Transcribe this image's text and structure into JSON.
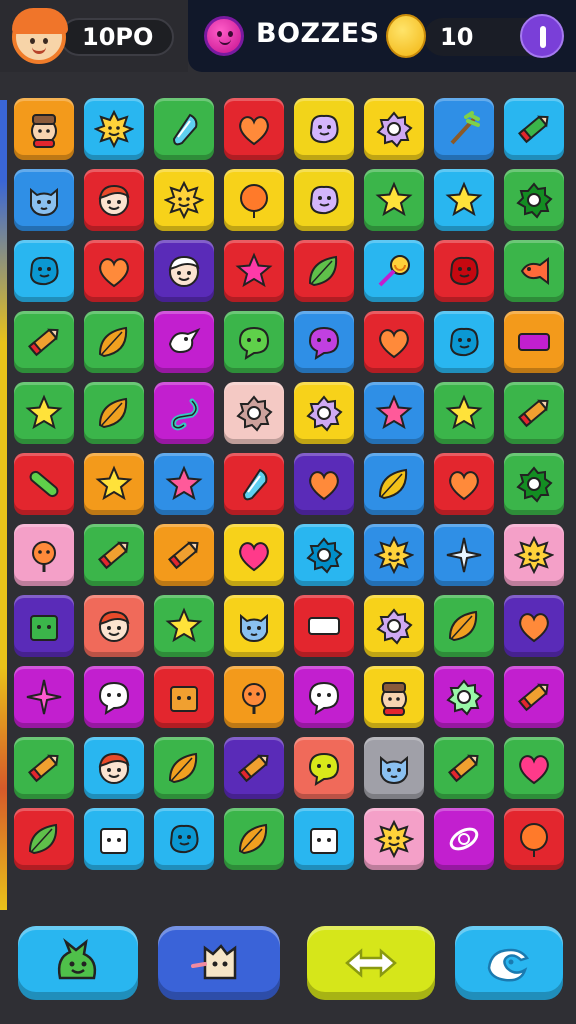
{
  "header": {
    "score": "10PO",
    "title": "BOZZES",
    "coins": "10"
  },
  "icons": {
    "avatar": "player-avatar-icon",
    "emoji": "pink-smiley-icon",
    "coin": "coin-icon",
    "pause": "pause-icon"
  },
  "colors": {
    "topbar": "#11182a",
    "background": "#2f2f34"
  },
  "board": {
    "rows": [
      [
        {
          "c": "#f39a1b",
          "g": "person"
        },
        {
          "c": "#29b6f0",
          "g": "sun"
        },
        {
          "c": "#3bb54a",
          "g": "drop"
        },
        {
          "c": "#e3262e",
          "g": "heart"
        },
        {
          "c": "#f2d41a",
          "g": "blob"
        },
        {
          "c": "#f7d21a",
          "g": "gear"
        },
        {
          "c": "#2f8fe6",
          "g": "branch"
        },
        {
          "c": "#29b6f0",
          "g": "crayon"
        }
      ],
      [
        {
          "c": "#2f8fe6",
          "g": "cat"
        },
        {
          "c": "#e3262e",
          "g": "face"
        },
        {
          "c": "#f7d21a",
          "g": "sun"
        },
        {
          "c": "#f7d21a",
          "g": "balloon"
        },
        {
          "c": "#f2d41a",
          "g": "blob"
        },
        {
          "c": "#3bb54a",
          "g": "star"
        },
        {
          "c": "#29b6f0",
          "g": "star"
        },
        {
          "c": "#3bb54a",
          "g": "gear"
        }
      ],
      [
        {
          "c": "#29b6f0",
          "g": "blob"
        },
        {
          "c": "#e3262e",
          "g": "heart"
        },
        {
          "c": "#5a2bb8",
          "g": "face"
        },
        {
          "c": "#e3262e",
          "g": "star"
        },
        {
          "c": "#e3262e",
          "g": "leaf"
        },
        {
          "c": "#29b6f0",
          "g": "candy"
        },
        {
          "c": "#e3262e",
          "g": "blob"
        },
        {
          "c": "#3bb54a",
          "g": "fish"
        }
      ],
      [
        {
          "c": "#3bb54a",
          "g": "crayon"
        },
        {
          "c": "#3bb54a",
          "g": "leaf"
        },
        {
          "c": "#c21fcf",
          "g": "bird"
        },
        {
          "c": "#3bb54a",
          "g": "bubble"
        },
        {
          "c": "#2f8fe6",
          "g": "bubble"
        },
        {
          "c": "#e3262e",
          "g": "heart"
        },
        {
          "c": "#29b6f0",
          "g": "blob"
        },
        {
          "c": "#f39a1b",
          "g": "bar"
        }
      ],
      [
        {
          "c": "#3bb54a",
          "g": "star"
        },
        {
          "c": "#3bb54a",
          "g": "leaf"
        },
        {
          "c": "#c21fcf",
          "g": "hook"
        },
        {
          "c": "#f4c9c4",
          "g": "gear"
        },
        {
          "c": "#f7d21a",
          "g": "gear"
        },
        {
          "c": "#2f8fe6",
          "g": "star"
        },
        {
          "c": "#3bb54a",
          "g": "star"
        },
        {
          "c": "#3bb54a",
          "g": "crayon"
        }
      ],
      [
        {
          "c": "#e3262e",
          "g": "stick"
        },
        {
          "c": "#f39a1b",
          "g": "star"
        },
        {
          "c": "#2f8fe6",
          "g": "star"
        },
        {
          "c": "#e3262e",
          "g": "drop"
        },
        {
          "c": "#5a2bb8",
          "g": "heart"
        },
        {
          "c": "#2f8fe6",
          "g": "leaf"
        },
        {
          "c": "#e3262e",
          "g": "heart"
        },
        {
          "c": "#3bb54a",
          "g": "gear"
        }
      ],
      [
        {
          "c": "#f4a0c8",
          "g": "flower"
        },
        {
          "c": "#3bb54a",
          "g": "crayon"
        },
        {
          "c": "#f39a1b",
          "g": "crayon"
        },
        {
          "c": "#f7d21a",
          "g": "heart"
        },
        {
          "c": "#29b6f0",
          "g": "gear"
        },
        {
          "c": "#2f8fe6",
          "g": "sun"
        },
        {
          "c": "#2f8fe6",
          "g": "sparkle"
        },
        {
          "c": "#f4a0c8",
          "g": "sun"
        }
      ],
      [
        {
          "c": "#5a2bb8",
          "g": "box"
        },
        {
          "c": "#f06a5a",
          "g": "face"
        },
        {
          "c": "#3bb54a",
          "g": "star"
        },
        {
          "c": "#f7d21a",
          "g": "cat"
        },
        {
          "c": "#e3262e",
          "g": "bar"
        },
        {
          "c": "#f7d21a",
          "g": "gear"
        },
        {
          "c": "#3bb54a",
          "g": "leaf"
        },
        {
          "c": "#5a2bb8",
          "g": "heart"
        }
      ],
      [
        {
          "c": "#c21fcf",
          "g": "sparkle"
        },
        {
          "c": "#c21fcf",
          "g": "bubble"
        },
        {
          "c": "#e3262e",
          "g": "box"
        },
        {
          "c": "#f39a1b",
          "g": "flower"
        },
        {
          "c": "#c21fcf",
          "g": "bubble"
        },
        {
          "c": "#f7d21a",
          "g": "person"
        },
        {
          "c": "#c21fcf",
          "g": "gear"
        },
        {
          "c": "#c21fcf",
          "g": "crayon"
        }
      ],
      [
        {
          "c": "#3bb54a",
          "g": "crayon"
        },
        {
          "c": "#29b6f0",
          "g": "face"
        },
        {
          "c": "#3bb54a",
          "g": "leaf"
        },
        {
          "c": "#5a2bb8",
          "g": "crayon"
        },
        {
          "c": "#f06a5a",
          "g": "bubble"
        },
        {
          "c": "#a0a0a8",
          "g": "cat"
        },
        {
          "c": "#3bb54a",
          "g": "crayon"
        },
        {
          "c": "#3bb54a",
          "g": "heart"
        }
      ],
      [
        {
          "c": "#e3262e",
          "g": "leaf"
        },
        {
          "c": "#29b6f0",
          "g": "box"
        },
        {
          "c": "#29b6f0",
          "g": "blob"
        },
        {
          "c": "#3bb54a",
          "g": "leaf"
        },
        {
          "c": "#29b6f0",
          "g": "box"
        },
        {
          "c": "#f4a0c8",
          "g": "sun"
        },
        {
          "c": "#c21fcf",
          "g": "ring"
        },
        {
          "c": "#e3262e",
          "g": "balloon"
        }
      ]
    ]
  },
  "actions": [
    {
      "name": "hint-button",
      "icon": "monster-icon",
      "color": "#29b6f0"
    },
    {
      "name": "shuffle-button",
      "icon": "creature-icon",
      "color": "#3a63d8"
    },
    {
      "name": "swap-button",
      "icon": "double-arrow-icon",
      "color": "#d6e61a"
    },
    {
      "name": "undo-button",
      "icon": "bird-icon",
      "color": "#29b6f0"
    }
  ]
}
